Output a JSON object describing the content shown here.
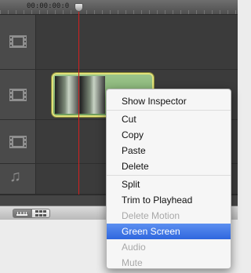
{
  "ruler": {
    "timecode": "00:00:00:0"
  },
  "tracks": [
    {
      "type": "video",
      "icon": "film-strip-icon"
    },
    {
      "type": "video",
      "icon": "film-strip-icon"
    },
    {
      "type": "video",
      "icon": "film-strip-icon"
    },
    {
      "type": "audio",
      "icon": "music-note-icon",
      "glyph": "♫"
    }
  ],
  "clip": {
    "color": "#8db87c",
    "border_color": "#e2e27a"
  },
  "playhead": {
    "color": "#d41f1f"
  },
  "view_toggle": {
    "options": [
      "timeline-view",
      "clip-view"
    ],
    "selected": "timeline-view"
  },
  "context_menu": {
    "items": [
      {
        "label": "Show Inspector",
        "enabled": true
      },
      {
        "label": "Cut",
        "enabled": true
      },
      {
        "label": "Copy",
        "enabled": true
      },
      {
        "label": "Paste",
        "enabled": true
      },
      {
        "label": "Delete",
        "enabled": true
      },
      {
        "label": "Split",
        "enabled": true
      },
      {
        "label": "Trim to Playhead",
        "enabled": true
      },
      {
        "label": "Delete Motion",
        "enabled": false
      },
      {
        "label": "Green Screen",
        "enabled": true,
        "highlighted": true
      },
      {
        "label": "Audio",
        "enabled": false
      },
      {
        "label": "Mute",
        "enabled": false
      }
    ]
  }
}
